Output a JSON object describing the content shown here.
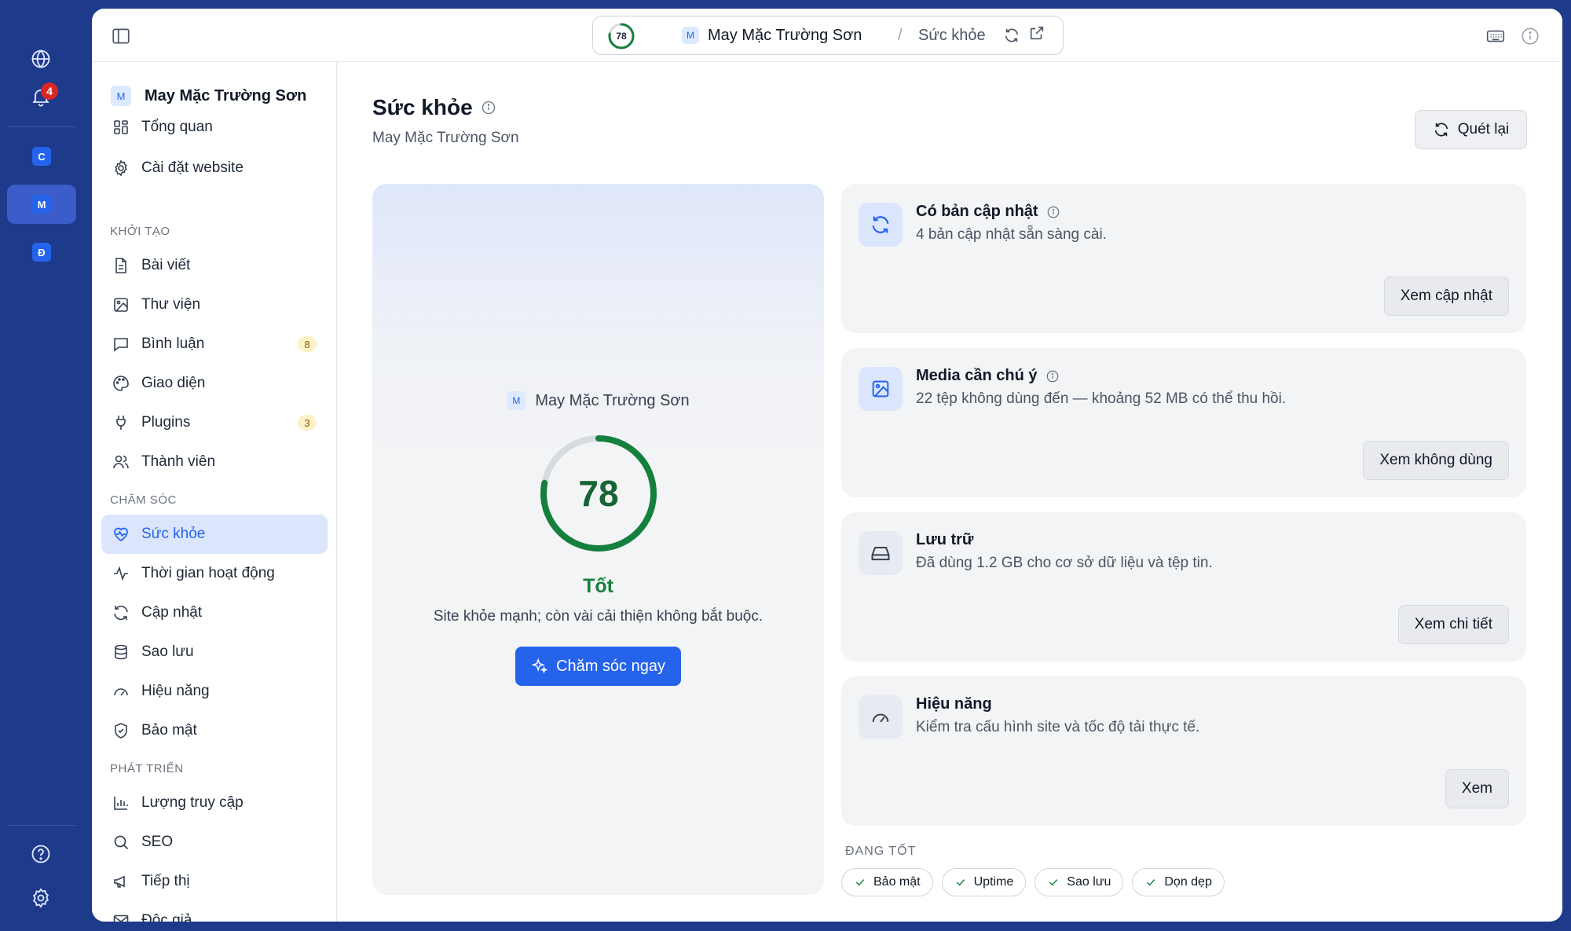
{
  "rail": {
    "notifications_count": "4",
    "sites": [
      {
        "letter": "C"
      },
      {
        "letter": "M"
      },
      {
        "letter": "Đ"
      }
    ]
  },
  "topbar": {
    "score": "78",
    "site_letter": "M",
    "site_name": "May Mặc Trường Sơn",
    "separator": "/",
    "page_name": "Sức khỏe"
  },
  "sidebar": {
    "site_letter": "M",
    "site_name": "May Mặc Trường Sơn",
    "items": [
      {
        "label": "Tổng quan"
      },
      {
        "label": "Cài đặt website"
      },
      {
        "label": "Bài viết"
      },
      {
        "label": "Thư viện"
      },
      {
        "label": "Bình luận",
        "count": "8"
      },
      {
        "label": "Giao diện"
      },
      {
        "label": "Plugins",
        "count": "3"
      },
      {
        "label": "Thành viên"
      },
      {
        "label": "Sức khỏe"
      },
      {
        "label": "Thời gian hoạt động"
      },
      {
        "label": "Cập nhật"
      },
      {
        "label": "Sao lưu"
      },
      {
        "label": "Hiệu năng"
      },
      {
        "label": "Bảo mật"
      },
      {
        "label": "Lượng truy cập"
      },
      {
        "label": "SEO"
      },
      {
        "label": "Tiếp thị"
      },
      {
        "label": "Độc giả"
      }
    ],
    "groups": [
      "KHỞI TẠO",
      "CHĂM SÓC",
      "PHÁT TRIỂN"
    ]
  },
  "main": {
    "title": "Sức khỏe",
    "subtitle": "May Mặc Trường Sơn",
    "rescan_label": "Quét lại",
    "score_card": {
      "site_letter": "M",
      "site_name": "May Mặc Trường Sơn",
      "score": "78",
      "score_value": 78,
      "status": "Tốt",
      "description": "Site khỏe mạnh; còn vài cải thiện không bắt buộc.",
      "action_label": "Chăm sóc ngay"
    },
    "cards": [
      {
        "title": "Có bản cập nhật",
        "description": "4 bản cập nhật sẵn sàng cài.",
        "action": "Xem cập nhật"
      },
      {
        "title": "Media cần chú ý",
        "description": "22 tệp không dùng đến — khoảng 52 MB có thể thu hồi.",
        "action": "Xem không dùng"
      },
      {
        "title": "Lưu trữ",
        "description": "Đã dùng 1.2 GB cho cơ sở dữ liệu và tệp tin.",
        "action": "Xem chi tiết"
      },
      {
        "title": "Hiệu năng",
        "description": "Kiểm tra cấu hình site và tốc độ tải thực tế.",
        "action": "Xem"
      }
    ],
    "good_label": "ĐANG TỐT",
    "good_chips": [
      "Bảo mật",
      "Uptime",
      "Sao lưu",
      "Dọn dẹp"
    ]
  },
  "colors": {
    "brand": "#1e3a8a",
    "accent": "#2563eb",
    "good": "#15803d",
    "badge": "#dc2626"
  }
}
